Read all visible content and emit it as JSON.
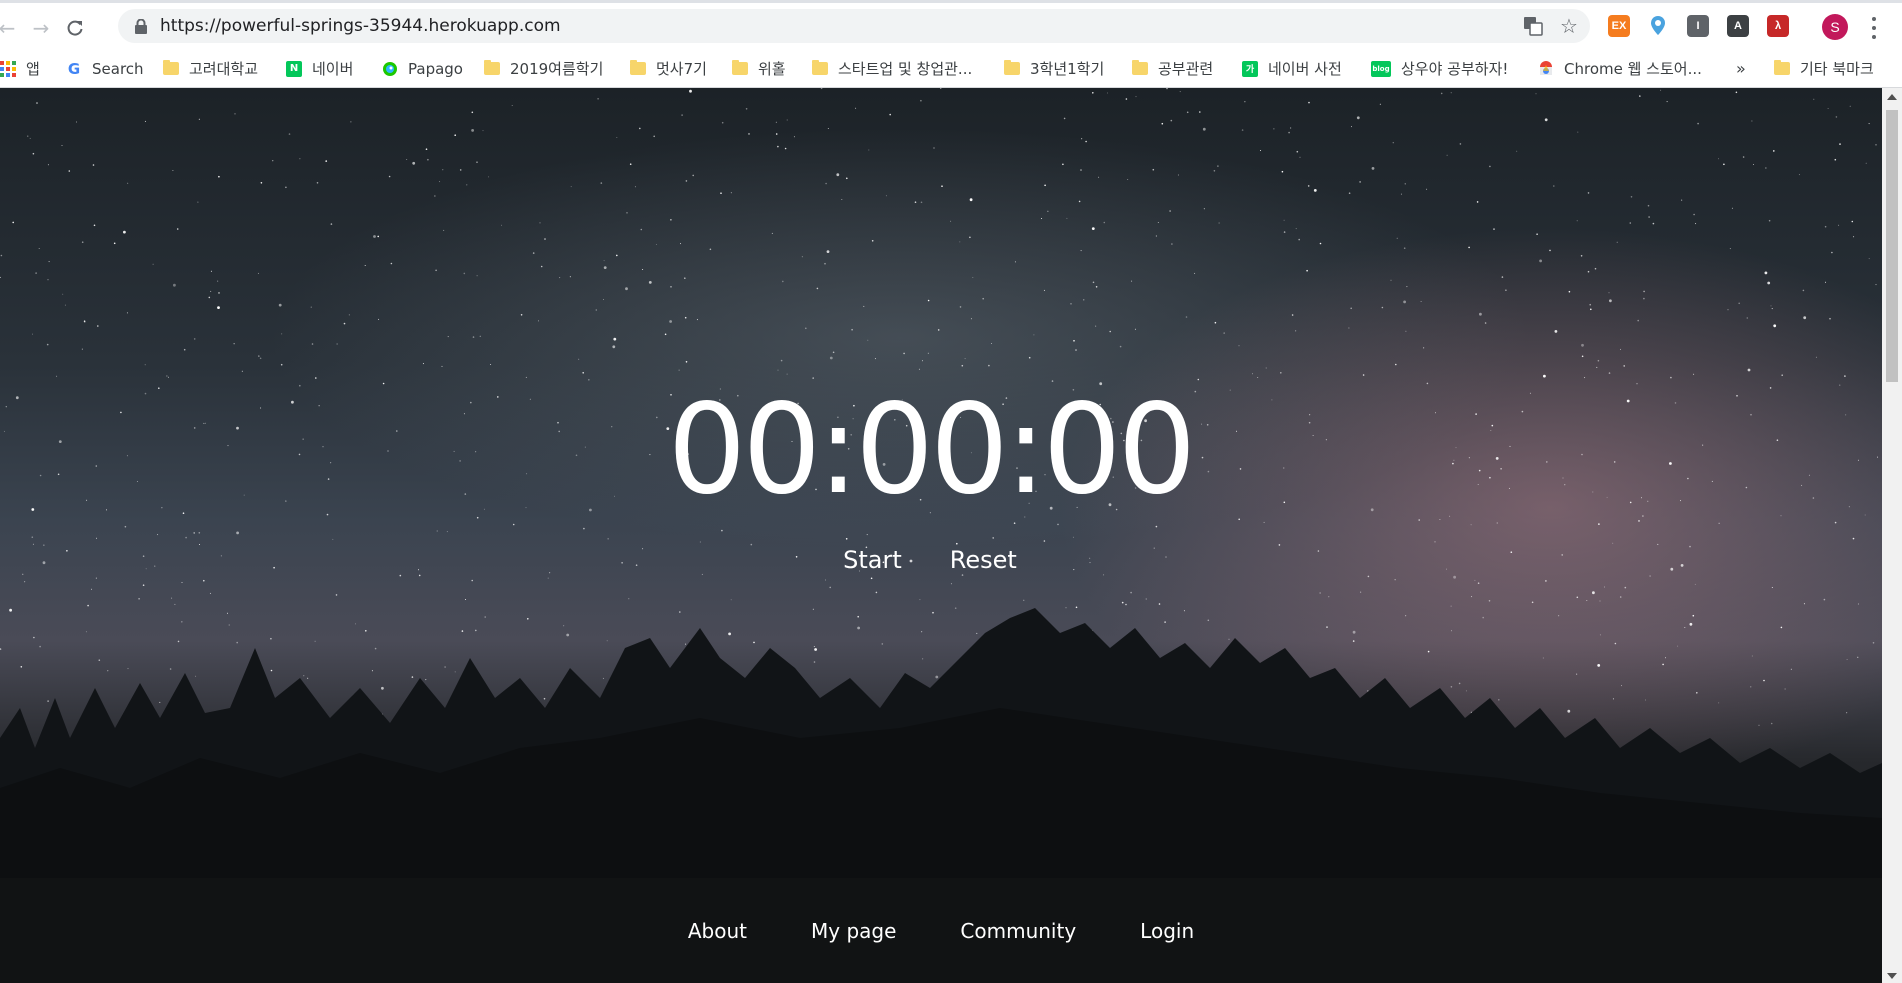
{
  "browser": {
    "url": "https://powerful-springs-35944.herokuapp.com",
    "profile_initial": "S",
    "ext_label": "EX"
  },
  "bookmarks": [
    {
      "label": "앱",
      "icon": "apps-icon"
    },
    {
      "label": "Search",
      "icon": "google-icon"
    },
    {
      "label": "고려대학교",
      "icon": "folder-icon"
    },
    {
      "label": "네이버",
      "icon": "naver-icon",
      "badge": "N"
    },
    {
      "label": "Papago",
      "icon": "papago-icon"
    },
    {
      "label": "2019여름학기",
      "icon": "folder-icon"
    },
    {
      "label": "멋사7기",
      "icon": "folder-icon"
    },
    {
      "label": "위홀",
      "icon": "folder-icon"
    },
    {
      "label": "스타트업 및 창업관...",
      "icon": "folder-icon"
    },
    {
      "label": "3학년1학기",
      "icon": "folder-icon"
    },
    {
      "label": "공부관련",
      "icon": "folder-icon"
    },
    {
      "label": "네이버 사전",
      "icon": "naver-dict-icon",
      "badge": "가"
    },
    {
      "label": "상우야 공부하자!",
      "icon": "blog-icon",
      "badge": "blog"
    },
    {
      "label": "Chrome 웹 스토어...",
      "icon": "chrome-store-icon"
    },
    {
      "label": "»",
      "icon": "overflow-icon"
    },
    {
      "label": "기타 북마크",
      "icon": "folder-icon"
    }
  ],
  "page": {
    "timer": "00:00:00",
    "start_label": "Start",
    "reset_label": "Reset",
    "footer": {
      "about": "About",
      "mypage": "My page",
      "community": "Community",
      "login": "Login"
    }
  },
  "colors": {
    "footer_bg": "#111314",
    "text": "#ffffff",
    "folder": "#f7d56a",
    "naver_green": "#03c75a",
    "avatar": "#c2185b"
  }
}
